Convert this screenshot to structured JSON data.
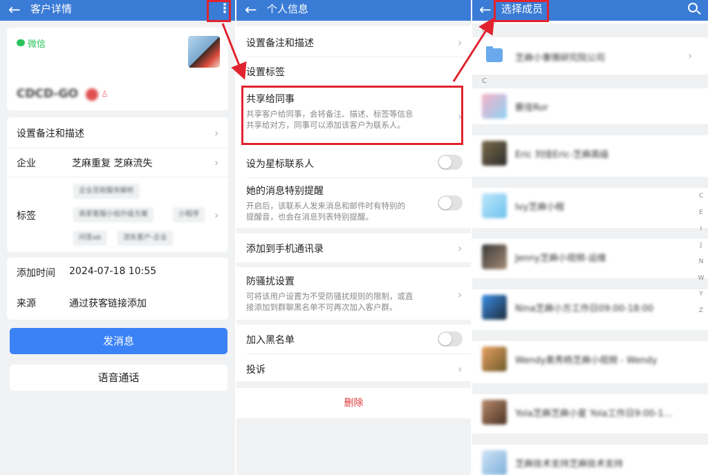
{
  "panel1": {
    "title": "客户详情",
    "wechat_label": "微信",
    "name": "CDCD-GO",
    "rows": {
      "remark_label": "设置备注和描述",
      "company_label": "企业",
      "company_value": "芝麻重复 芝麻流失",
      "tags_label": "标签",
      "tags": [
        "企业员助服务解析",
        "商家客服小组升级方案",
        "小程序",
        "问答ab",
        "流失客户-企业"
      ],
      "added_time_label": "添加时间",
      "added_time_value": "2024-07-18 10:55",
      "source_label": "来源",
      "source_value": "通过获客链接添加"
    },
    "send_message_label": "发消息",
    "voice_call_label": "语音通话"
  },
  "panel2": {
    "title": "个人信息",
    "items": {
      "remark_label": "设置备注和描述",
      "tag_label": "设置标签",
      "share_label": "共享给同事",
      "share_desc": "共享客户给同事，会将备注、描述、标签等信息共享给对方，同事可以添加该客户为联系人。",
      "star_label": "设为星标联系人",
      "remind_label": "她的消息特别提醒",
      "remind_desc": "开启后，该联系人发来消息和邮件时有特别的提醒音，也会在消息列表特别提醒。",
      "phone_label": "添加到手机通讯录",
      "harass_label": "防骚扰设置",
      "harass_desc": "可将该用户设置为不受防骚扰规则的限制，或直接添加到群聊黑名单不可再次加入客户群。",
      "blacklist_label": "加入黑名单",
      "complain_label": "投诉",
      "delete_label": "删除"
    },
    "toggles": {
      "star": false,
      "remind": false,
      "blacklist": false
    }
  },
  "panel3": {
    "title": "选择成员",
    "top_section": "门",
    "org_name": "芝麻小事情研究院公司",
    "section_c": "C",
    "contacts": [
      "蔡佳Ror",
      "Eric 刘佳Eric-芝麻高级",
      "Ivy芝麻小程",
      "Jenny芝麻小视频-运维",
      "Nina芝麻小方工作日09:00-18:00",
      "Wendy奥秀杨芝麻小视频 - Wendy",
      "Yola芝麻芝麻小星 Yola工作日9:00-1...",
      "芝麻技术支持芝麻技术支持"
    ],
    "index_letters": [
      "C",
      "E",
      "I",
      "J",
      "N",
      "W",
      "Y",
      "Z"
    ]
  },
  "colors": {
    "header": "#3a7bd5",
    "accent": "#3b82f6",
    "danger": "#e03b3b",
    "highlight": "#e0232e",
    "wechat": "#2bc35c"
  }
}
